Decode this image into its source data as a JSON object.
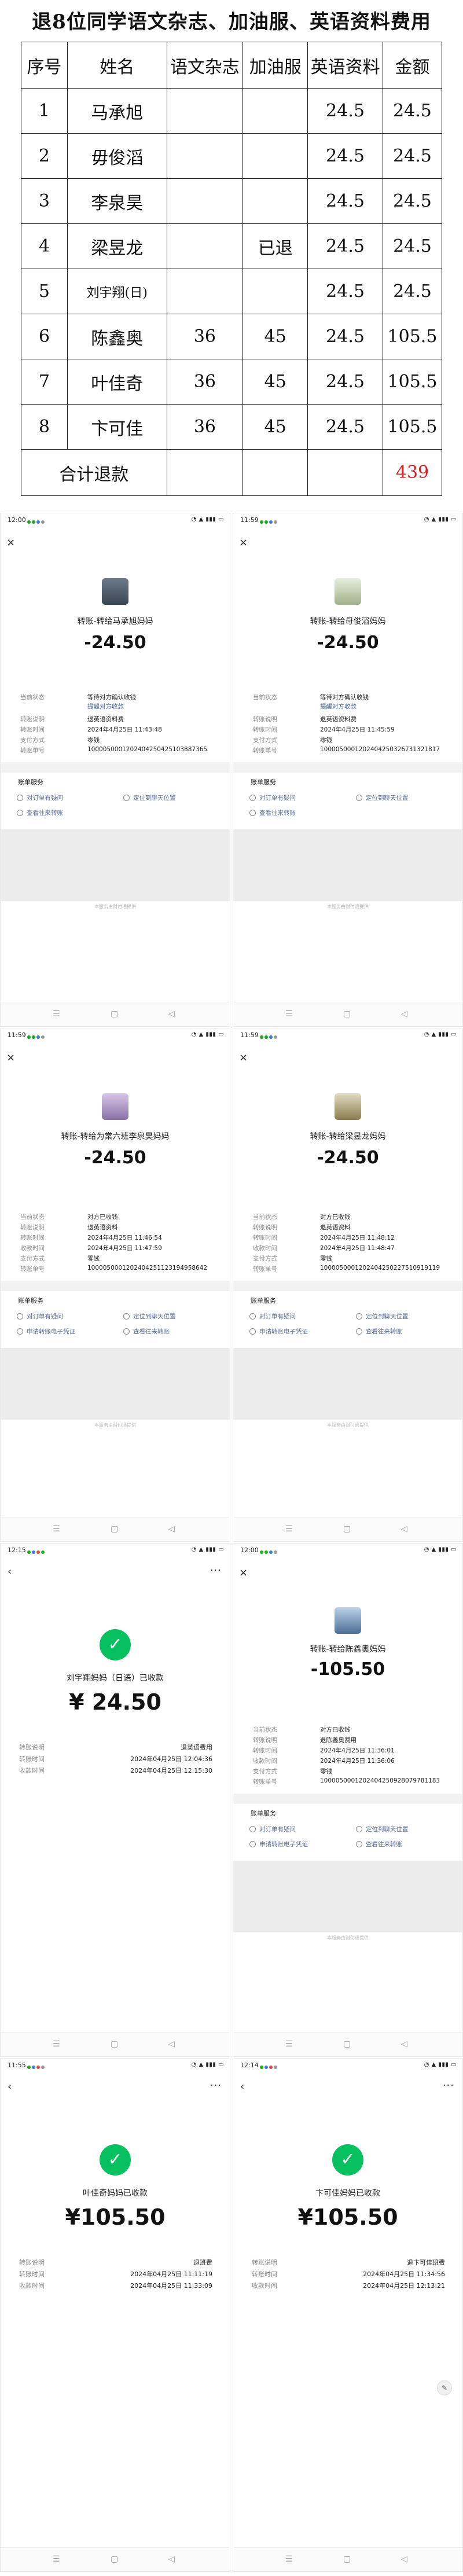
{
  "doc": {
    "title": "退8位同学语文杂志、加油服、英语资料费用",
    "headers": [
      "序号",
      "姓名",
      "语文杂志",
      "加油服",
      "英语资料",
      "金额"
    ],
    "rows": [
      [
        "1",
        "马承旭",
        "",
        "",
        "24.5",
        "24.5"
      ],
      [
        "2",
        "毋俊滔",
        "",
        "",
        "24.5",
        "24.5"
      ],
      [
        "3",
        "李泉昊",
        "",
        "",
        "24.5",
        "24.5"
      ],
      [
        "4",
        "梁昱龙",
        "",
        "已退",
        "24.5",
        "24.5"
      ],
      [
        "5",
        "刘宇翔(日)",
        "",
        "",
        "24.5",
        "24.5"
      ],
      [
        "6",
        "陈鑫奥",
        "36",
        "45",
        "24.5",
        "105.5"
      ],
      [
        "7",
        "叶佳奇",
        "36",
        "45",
        "24.5",
        "105.5"
      ],
      [
        "8",
        "卞可佳",
        "36",
        "45",
        "24.5",
        "105.5"
      ]
    ],
    "total_label": "合计退款",
    "total_value": "439",
    "accent_red": "#d62222"
  },
  "common": {
    "service_header": "账单服务",
    "svc_question": "对订单有疑问",
    "svc_locate": "定位到聊天位置",
    "svc_view": "查看往来转账",
    "svc_voucher": "申请转账电子凭证",
    "ad_text": "本服务由财付通提供",
    "close_icon": "×",
    "back_icon": "‹",
    "more_icon": "···",
    "check_icon": "✓",
    "nav_menu": "☰",
    "nav_home": "▢",
    "nav_back": "◁",
    "brand_green": "#07c160",
    "link_blue": "#576b95"
  },
  "shots": [
    {
      "time": "12:00",
      "title": "转账-转给马承旭妈妈",
      "amount": "-24.50",
      "rows": [
        [
          "当前状态",
          "等待对方确认收钱"
        ],
        [
          "",
          "提醒对方收款"
        ],
        [
          "转账说明",
          "退英语资料费"
        ],
        [
          "转账时间",
          "2024年4月25日 11:43:48"
        ],
        [
          "支付方式",
          "零钱"
        ],
        [
          "转账单号",
          "1000050001202404250425103887365"
        ]
      ]
    },
    {
      "time": "11:59",
      "title": "转账-转给母俊滔妈妈",
      "amount": "-24.50",
      "rows": [
        [
          "当前状态",
          "等待对方确认收钱"
        ],
        [
          "",
          "提醒对方收款"
        ],
        [
          "转账说明",
          "退英语资料费"
        ],
        [
          "转账时间",
          "2024年4月25日 11:45:59"
        ],
        [
          "支付方式",
          "零钱"
        ],
        [
          "转账单号",
          "1000050001202404250326731321817"
        ]
      ]
    },
    {
      "time": "11:59",
      "title": "转账-转给为棠六班李泉昊妈妈",
      "amount": "-24.50",
      "rows": [
        [
          "当前状态",
          "对方已收钱"
        ],
        [
          "转账说明",
          "退英语资料"
        ],
        [
          "转账时间",
          "2024年4月25日 11:46:54"
        ],
        [
          "收款时间",
          "2024年4月25日 11:47:59"
        ],
        [
          "支付方式",
          "零钱"
        ],
        [
          "转账单号",
          "1000050001202404251123194958642"
        ]
      ]
    },
    {
      "time": "11:59",
      "title": "转账-转给梁昱龙妈妈",
      "amount": "-24.50",
      "rows": [
        [
          "当前状态",
          "对方已收钱"
        ],
        [
          "转账说明",
          "退英语资料"
        ],
        [
          "转账时间",
          "2024年4月25日 11:48:12"
        ],
        [
          "收款时间",
          "2024年4月25日 11:48:47"
        ],
        [
          "支付方式",
          "零钱"
        ],
        [
          "转账单号",
          "1000050001202404250227510919119"
        ]
      ]
    },
    {
      "time": "12:15",
      "title": "刘宇翔妈妈（日语）已收款",
      "amount": "24.50",
      "rows": [
        [
          "转账说明",
          "退英语费用"
        ],
        [
          "转账时间",
          "2024年04月25日 12:04:36"
        ],
        [
          "收款时间",
          "2024年04月25日 12:15:30"
        ]
      ]
    },
    {
      "time": "12:00",
      "title": "转账-转给陈鑫奥妈妈",
      "amount": "-105.50",
      "rows": [
        [
          "当前状态",
          "对方已收钱"
        ],
        [
          "转账说明",
          "退陈鑫奥费用"
        ],
        [
          "转账时间",
          "2024年4月25日 11:36:01"
        ],
        [
          "收款时间",
          "2024年4月25日 11:36:06"
        ],
        [
          "支付方式",
          "零钱"
        ],
        [
          "转账单号",
          "1000050001202404250928079781183"
        ]
      ]
    },
    {
      "time": "11:55",
      "title": "叶佳奇妈妈已收款",
      "amount": "105.50",
      "rows": [
        [
          "转账说明",
          "退班费"
        ],
        [
          "转账时间",
          "2024年04月25日 11:11:19"
        ],
        [
          "收款时间",
          "2024年04月25日 11:33:09"
        ]
      ]
    },
    {
      "time": "12:14",
      "title": "卞可佳妈妈已收款",
      "amount": "105.50",
      "rows": [
        [
          "转账说明",
          "退卞可佳班费"
        ],
        [
          "转账时间",
          "2024年04月25日 11:34:56"
        ],
        [
          "收款时间",
          "2024年04月25日 12:13:21"
        ]
      ]
    }
  ]
}
